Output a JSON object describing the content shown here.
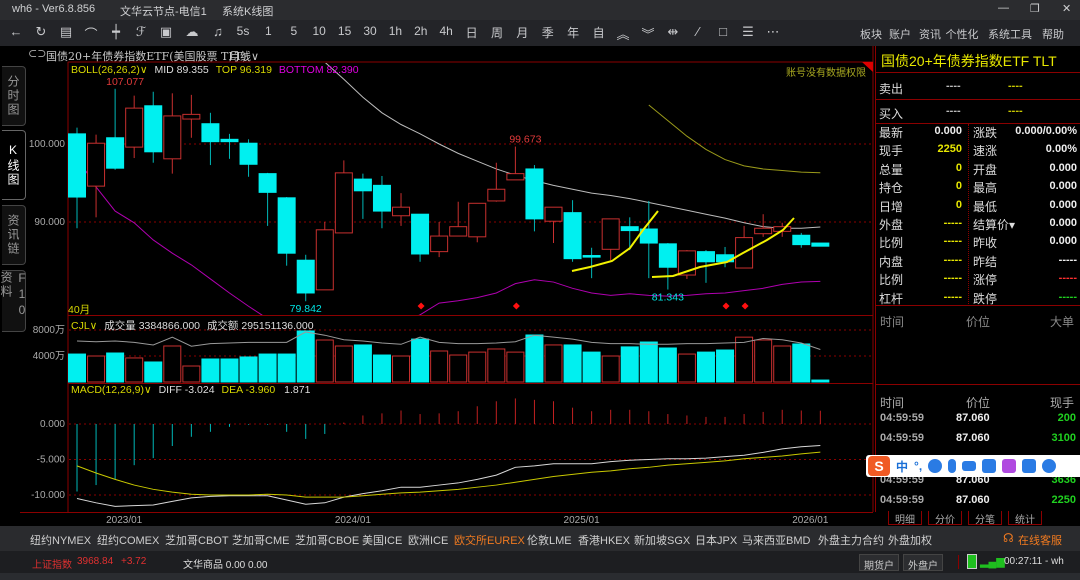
{
  "titlebar": {
    "app": "wh6  -  Ver6.8.856",
    "server": "文华云节点-电信1",
    "window": "系统K线图",
    "min": "—",
    "max": "❐",
    "close": "✕"
  },
  "toolbar": {
    "icons": [
      {
        "name": "back-arrow-icon",
        "glyph": "←"
      },
      {
        "name": "refresh-icon",
        "glyph": "↻"
      },
      {
        "name": "table-icon",
        "glyph": "▤"
      },
      {
        "name": "line-chart-icon",
        "glyph": "⌒"
      },
      {
        "name": "candlestick-icon",
        "glyph": "┿"
      },
      {
        "name": "draw-tool-icon",
        "glyph": "ℱ"
      },
      {
        "name": "picture-frame-icon",
        "glyph": "▣"
      },
      {
        "name": "cloud-icon",
        "glyph": "☁"
      },
      {
        "name": "bell-icon",
        "glyph": "♫"
      }
    ],
    "periods": [
      "5s",
      "1",
      "5",
      "10",
      "15",
      "30",
      "1h",
      "2h",
      "4h",
      "日",
      "周",
      "月",
      "季",
      "年",
      "自"
    ],
    "tools": [
      {
        "name": "zoom-in-icon",
        "glyph": "︽"
      },
      {
        "name": "zoom-out-icon",
        "glyph": "︾"
      },
      {
        "name": "range-icon",
        "glyph": "⇹"
      },
      {
        "name": "line-draw-icon",
        "glyph": "∕"
      },
      {
        "name": "rectangle-icon",
        "glyph": "□"
      },
      {
        "name": "list-icon",
        "glyph": "☰"
      },
      {
        "name": "more-icon",
        "glyph": "⋯"
      }
    ],
    "menu": [
      "板块",
      "账户",
      "资讯",
      "个性化",
      "系统工具",
      "帮助"
    ]
  },
  "chart_header": {
    "instrument": "国债20+年债券指数ETF(美国股票 TLT)",
    "period": "月线∨"
  },
  "left_tabs": [
    "分时图",
    "K线图",
    "资讯链",
    "F10资料"
  ],
  "chart_data": {
    "type": "candlestick",
    "title": "国债20+年债券指数ETF TLT 月线",
    "period_count_label": "40月",
    "permission_note": "账号没有数据权限",
    "boll": {
      "label": "BOLL(26,26,2)∨",
      "mid": "MID 89.355",
      "top": "TOP 96.319",
      "bottom": "BOTTOM 82.390"
    },
    "price_ticks": [
      {
        "v": 100,
        "label": "100.000"
      },
      {
        "v": 90,
        "label": "90.000"
      }
    ],
    "x_labels": [
      {
        "i": 3,
        "label": "2023/01"
      },
      {
        "i": 15,
        "label": "2024/01"
      },
      {
        "i": 27,
        "label": "2025/01"
      },
      {
        "i": 39,
        "label": "2026/01"
      }
    ],
    "ohlc": [
      [
        101.3,
        102.1,
        89.2,
        93.2
      ],
      [
        94.6,
        101.2,
        90.6,
        100.1
      ],
      [
        100.8,
        107.077,
        96.7,
        96.9
      ],
      [
        99.6,
        106.2,
        98.2,
        104.6
      ],
      [
        104.9,
        106.7,
        97.6,
        99.0
      ],
      [
        98.1,
        106.5,
        96.2,
        103.6
      ],
      [
        103.2,
        106.3,
        100.8,
        103.8
      ],
      [
        102.6,
        104.0,
        97.3,
        100.3
      ],
      [
        100.6,
        101.3,
        98.1,
        100.3
      ],
      [
        100.1,
        100.6,
        95.8,
        97.4
      ],
      [
        96.2,
        96.3,
        89.5,
        93.8
      ],
      [
        93.1,
        93.2,
        84.4,
        86.0
      ],
      [
        85.1,
        85.8,
        79.842,
        80.9
      ],
      [
        81.3,
        90.0,
        81.3,
        89.0
      ],
      [
        88.6,
        97.9,
        88.6,
        96.3
      ],
      [
        95.5,
        96.2,
        90.4,
        94.0
      ],
      [
        94.7,
        95.9,
        89.2,
        91.4
      ],
      [
        90.8,
        93.7,
        89.5,
        91.9
      ],
      [
        91.0,
        91.0,
        84.9,
        85.9
      ],
      [
        86.2,
        90.0,
        85.5,
        88.2
      ],
      [
        88.2,
        92.6,
        88.2,
        89.4
      ],
      [
        88.1,
        92.4,
        87.4,
        92.4
      ],
      [
        92.7,
        97.6,
        92.6,
        94.2
      ],
      [
        95.4,
        99.673,
        95.4,
        96.2
      ],
      [
        96.8,
        97.3,
        88.8,
        90.4
      ],
      [
        90.1,
        91.9,
        87.3,
        91.9
      ],
      [
        91.2,
        92.8,
        84.9,
        85.3
      ],
      [
        85.7,
        86.7,
        82.8,
        85.5
      ],
      [
        86.5,
        90.4,
        85.1,
        90.4
      ],
      [
        89.4,
        90.6,
        86.4,
        88.9
      ],
      [
        89.1,
        92.7,
        82.8,
        87.3
      ],
      [
        87.2,
        87.3,
        81.343,
        84.2
      ],
      [
        83.2,
        86.4,
        82.7,
        86.3
      ],
      [
        86.2,
        86.4,
        82.2,
        84.9
      ],
      [
        85.8,
        86.8,
        84.2,
        84.9
      ],
      [
        84.1,
        89.5,
        84.1,
        88.0
      ],
      [
        88.5,
        91.0,
        88.1,
        89.2
      ],
      [
        88.8,
        89.9,
        88.1,
        89.4
      ],
      [
        88.3,
        88.6,
        86.7,
        87.1
      ],
      [
        87.3,
        87.3,
        86.9,
        86.9
      ]
    ],
    "boll_mid": [
      null,
      null,
      null,
      null,
      null,
      null,
      null,
      null,
      null,
      null,
      null,
      null,
      null,
      110.5,
      108.3,
      106,
      104,
      102.5,
      101.3,
      100,
      98.8,
      97.8,
      96.8,
      96,
      95.3,
      94.7,
      94.2,
      93.7,
      93.4,
      93,
      92.5,
      92,
      91.5,
      91,
      90.5,
      89.9,
      89.4,
      89.2,
      89.2,
      89.355
    ],
    "boll_top": [
      null,
      null,
      null,
      null,
      null,
      null,
      null,
      null,
      null,
      null,
      null,
      null,
      null,
      null,
      null,
      null,
      null,
      null,
      null,
      null,
      null,
      null,
      null,
      null,
      null,
      null,
      null,
      null,
      null,
      null,
      105,
      103,
      101,
      99.3,
      98,
      97.2,
      96.8,
      96.6,
      96.4,
      96.319
    ],
    "boll_bottom": [
      98.3,
      94.5,
      91.4,
      89.9,
      87.7,
      86,
      84.5,
      82.7,
      80.9,
      79.2,
      77.6,
      76,
      75,
      75,
      75.5,
      76.5,
      77.5,
      77,
      78.1,
      79.6,
      79.9,
      80.3,
      80.9,
      82.1,
      82.6,
      82.3,
      81.5,
      80.9,
      80.6,
      80.8,
      80.6,
      80.5,
      80.6,
      80.8,
      80.9,
      81.2,
      81.5,
      82,
      82.3,
      82.39
    ],
    "annotations": [
      {
        "i": 2,
        "v": 107.077,
        "label": "107.077",
        "color": "#e03a3a",
        "pos": "above"
      },
      {
        "i": 23,
        "v": 99.673,
        "label": "99.673",
        "color": "#e03a3a",
        "pos": "above"
      },
      {
        "i": 12,
        "v": 79.842,
        "label": "79.842",
        "color": "#00e5e5",
        "pos": "below"
      },
      {
        "i": 31,
        "v": 81.343,
        "label": "81.343",
        "color": "#00e5e5",
        "pos": "below"
      }
    ],
    "signals": [
      18,
      23,
      34,
      35
    ],
    "volume": {
      "label": "CJL∨",
      "vol_text": "成交量 3384866.000",
      "amt_text": "成交额 295151136.000",
      "ticks": [
        {
          "v": 8000,
          "label": "8000万"
        },
        {
          "v": 4000,
          "label": "4000万"
        }
      ],
      "values": [
        4300,
        4000,
        4460,
        3700,
        3080,
        5540,
        2460,
        3540,
        3540,
        3850,
        4300,
        4300,
        7850,
        6460,
        5540,
        5700,
        4150,
        4000,
        6600,
        4770,
        4150,
        4600,
        5080,
        4600,
        7230,
        5700,
        5700,
        4600,
        4000,
        5400,
        6150,
        5230,
        4300,
        4600,
        4920,
        6900,
        6460,
        5540,
        5850,
        300
      ],
      "ma": [
        6300,
        6200,
        6300,
        6100,
        5700,
        6900,
        5500,
        5900,
        6000,
        6100,
        6100,
        6100,
        7700,
        7200,
        6500,
        6300,
        6000,
        5800,
        6900,
        6100,
        5900,
        5900,
        6000,
        6200,
        7200,
        6900,
        6600,
        6100,
        5900,
        5900,
        5800,
        5800,
        5900,
        5900,
        6000,
        6100,
        6700,
        6500,
        6000,
        5000
      ]
    },
    "macd": {
      "label": "MACD(12,26,9)∨",
      "diff_text": "DIFF -3.024",
      "dea_text": "DEA -3.960",
      "macd_text": "1.871",
      "ticks": [
        {
          "v": 0,
          "label": "0.000"
        },
        {
          "v": -5,
          "label": "-5.000"
        },
        {
          "v": -10,
          "label": "-10.000"
        }
      ],
      "hist": [
        -9.5,
        -8.6,
        -7.8,
        -5.8,
        -4.8,
        -3.1,
        -1.8,
        -1.1,
        -0.4,
        -0.1,
        -0.1,
        -1.1,
        -2.1,
        -1.4,
        0.2,
        1.2,
        1.5,
        1.9,
        1.4,
        1.5,
        1.8,
        2.5,
        3.2,
        3.6,
        3.4,
        3.2,
        2.3,
        1.8,
        2.0,
        2.0,
        1.8,
        1.4,
        1.2,
        1.0,
        1.0,
        1.4,
        1.7,
        2.0,
        1.9,
        1.871
      ],
      "diff": [
        -10.5,
        -11.1,
        -11.6,
        -11.5,
        -11.4,
        -10.9,
        -10.4,
        -10.2,
        -10.1,
        -10.1,
        -10.1,
        -10.7,
        -11.3,
        -11.1,
        -10.3,
        -9.8,
        -9.4,
        -8.9,
        -8.9,
        -8.6,
        -8.3,
        -7.8,
        -7.2,
        -6.1,
        -5.9,
        -5.6,
        -5.6,
        -5.6,
        -5.3,
        -5.1,
        -5.0,
        -4.9,
        -4.9,
        -4.8,
        -4.6,
        -4.4,
        -4.0,
        -3.5,
        -3.2,
        -3.024
      ],
      "dea": [
        -5.9,
        -6.9,
        -7.8,
        -8.6,
        -9.2,
        -9.6,
        -9.9,
        -10.0,
        -10.0,
        -10.0,
        -9.9,
        -10.0,
        -10.3,
        -10.3,
        -10.3,
        -10.1,
        -9.9,
        -9.7,
        -9.6,
        -9.4,
        -9.2,
        -8.9,
        -8.6,
        -8.2,
        -7.8,
        -7.4,
        -7.1,
        -6.8,
        -6.6,
        -6.3,
        -6.1,
        -5.8,
        -5.6,
        -5.4,
        -5.2,
        -4.9,
        -4.7,
        -4.5,
        -4.2,
        -3.96
      ]
    },
    "colors": {
      "up": "#c8302f",
      "down": "#00f0f0",
      "mid": "#bcbcbc",
      "top": "#9a9a1a",
      "bottom": "#b000b0",
      "diff": "#d8d8d8",
      "dea": "#c8c800"
    }
  },
  "quote": {
    "title": "国债20+年债券指数ETF  TLT",
    "sell_label": "卖出",
    "buy_label": "买入",
    "dash1": "----",
    "dash2": "----",
    "rows": [
      {
        "l": "最新",
        "lv": "0.000",
        "lc": "#eee",
        "r": "涨跌",
        "rv": "0.000/0.00%",
        "rc": "#eee"
      },
      {
        "l": "现手",
        "lv": "2250",
        "lc": "#e8e800",
        "r": "速涨",
        "rv": "0.00%",
        "rc": "#eee"
      },
      {
        "l": "总量",
        "lv": "0",
        "lc": "#e8e800",
        "r": "开盘",
        "rv": "0.000",
        "rc": "#eee"
      },
      {
        "l": "持仓",
        "lv": "0",
        "lc": "#e8e800",
        "r": "最高",
        "rv": "0.000",
        "rc": "#eee"
      },
      {
        "l": "日增",
        "lv": "0",
        "lc": "#e8e800",
        "r": "最低",
        "rv": "0.000",
        "rc": "#eee"
      },
      {
        "l": "外盘",
        "lv": "-----",
        "lc": "#e8e800",
        "r": "结算价▾",
        "rv": "0.000",
        "rc": "#eee"
      },
      {
        "l": "比例",
        "lv": "-----",
        "lc": "#e8e800",
        "r": "昨收",
        "rv": "0.000",
        "rc": "#eee"
      },
      {
        "l": "内盘",
        "lv": "-----",
        "lc": "#e8e800",
        "r": "昨结",
        "rv": "-----",
        "rc": "#eee"
      },
      {
        "l": "比例",
        "lv": "-----",
        "lc": "#e8e800",
        "r": "涨停",
        "rv": "-----",
        "rc": "#ff3030"
      },
      {
        "l": "杠杆",
        "lv": "-----",
        "lc": "#e8e800",
        "r": "跌停",
        "rv": "-----",
        "rc": "#20d020"
      }
    ],
    "big_header": [
      "时间",
      "价位",
      "大单"
    ],
    "ticks_header": [
      "时间",
      "价位",
      "现手"
    ],
    "ticks": [
      {
        "t": "04:59:59",
        "p": "87.060",
        "q": "200"
      },
      {
        "t": "04:59:59",
        "p": "87.060",
        "q": "3100"
      },
      {
        "t": "04:59:59",
        "p": "87.060",
        "q": "3636"
      },
      {
        "t": "04:59:59",
        "p": "87.060",
        "q": "2250"
      }
    ],
    "tabs": [
      "明细",
      "分价",
      "分笔",
      "统计"
    ]
  },
  "ime": {
    "lang": "中",
    "punct": "°,"
  },
  "exchanges": [
    "纽约NYMEX",
    "纽约COMEX",
    "芝加哥CBOT",
    "芝加哥CME",
    "芝加哥CBOE",
    "美国ICE",
    "欧洲ICE",
    "欧交所EUREX",
    "伦敦LME",
    "香港HKEX",
    "新加坡SGX",
    "日本JPX",
    "马来西亚BMD",
    "外盘主力合约",
    "外盘加权"
  ],
  "active_exchange": "欧交所EUREX",
  "service": "在线客服",
  "status": {
    "index_name": "上证指数",
    "index_value": "3968.84",
    "index_change": "+3.72",
    "commodity": "文华商品 0.00 0.00",
    "btn1": "期货户",
    "btn2": "外盘户",
    "time": "00:27:11 - wh"
  }
}
